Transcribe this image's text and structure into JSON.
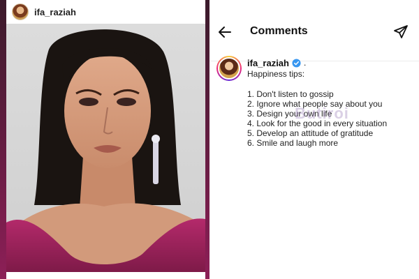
{
  "post": {
    "username": "ifa_raziah"
  },
  "comments_screen": {
    "title": "Comments",
    "comment": {
      "username": "ifa_raziah",
      "dot": ".",
      "intro": "Happiness tips:",
      "tips": [
        "1. Don't listen to gossip",
        "2. Ignore what people say about you",
        "3. Design your own life",
        "4. Look for the good in every situation",
        "5. Develop an attitude of gratitude",
        "6. Smile and laugh more"
      ]
    }
  },
  "watermark": "Butiroi",
  "colors": {
    "verified": "#3897f0",
    "dress": "#a0245f",
    "background_panel": "#5a1538"
  },
  "icons": {
    "back": "arrow-left-icon",
    "send": "paper-plane-icon",
    "verified": "verified-badge-icon"
  }
}
